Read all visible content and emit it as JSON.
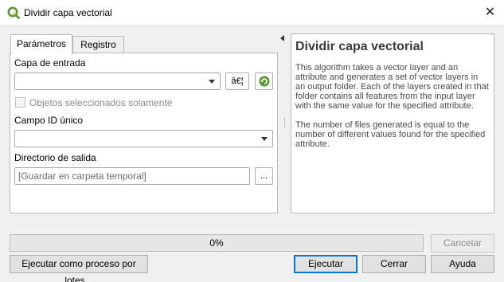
{
  "window": {
    "title": "Dividir capa vectorial",
    "close_glyph": "✕"
  },
  "tabs": [
    {
      "label": "Parámetros"
    },
    {
      "label": "Registro"
    }
  ],
  "params": {
    "input_layer_label": "Capa de entrada",
    "input_layer_value": "",
    "settings_glyph": "â€¦",
    "selected_only_label": "Objetos seleccionados solamente",
    "unique_id_label": "Campo ID único",
    "unique_id_value": "",
    "output_dir_label": "Directorio de salida",
    "output_dir_placeholder": "[Guardar en carpeta temporal]",
    "browse_label": "..."
  },
  "help": {
    "title": "Dividir capa vectorial",
    "paragraphs": [
      "This algorithm takes a vector layer and an attribute and generates a set of vector layers in an output folder. Each of the layers created in that folder contains all features from the input layer with the same value for the specified attribute.",
      "The number of files generated is equal to the number of different values found for the specified attribute."
    ]
  },
  "progress": {
    "label": "0%",
    "value": 0
  },
  "buttons": {
    "cancel": "Cancelar",
    "batch": "Ejecutar como proceso por lotes...",
    "run": "Ejecutar",
    "close": "Cerrar",
    "help": "Ayuda"
  },
  "colors": {
    "qgis_green": "#589632",
    "qgis_yellow": "#eeb935",
    "focus_blue": "#0078d7"
  },
  "icons": {
    "app": "qgis-icon",
    "iterate": "iterate-icon",
    "combo": "chevron-down-icon"
  }
}
